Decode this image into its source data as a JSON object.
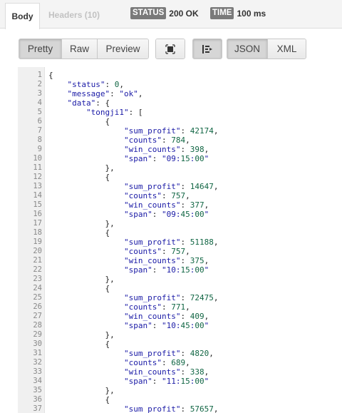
{
  "tabs": {
    "body_label": "Body",
    "headers_label": "Headers (10)"
  },
  "status": {
    "label": "STATUS",
    "value": "200 OK"
  },
  "time": {
    "label": "TIME",
    "value": "100 ms"
  },
  "toolbar": {
    "view_modes": [
      "Pretty",
      "Raw",
      "Preview"
    ],
    "formats": [
      "JSON",
      "XML"
    ],
    "icons": [
      "expand-icon",
      "wrap-icon"
    ]
  },
  "code_lines": [
    "{",
    "    \"status\": 0,",
    "    \"message\": \"ok\",",
    "    \"data\": {",
    "        \"tongji1\": [",
    "            {",
    "                \"sum_profit\": 42174,",
    "                \"counts\": 784,",
    "                \"win_counts\": 398,",
    "                \"span\": \"09:15:00\"",
    "            },",
    "            {",
    "                \"sum_profit\": 14647,",
    "                \"counts\": 757,",
    "                \"win_counts\": 377,",
    "                \"span\": \"09:45:00\"",
    "            },",
    "            {",
    "                \"sum_profit\": 51188,",
    "                \"counts\": 757,",
    "                \"win_counts\": 375,",
    "                \"span\": \"10:15:00\"",
    "            },",
    "            {",
    "                \"sum_profit\": 72475,",
    "                \"counts\": 771,",
    "                \"win_counts\": 409,",
    "                \"span\": \"10:45:00\"",
    "            },",
    "            {",
    "                \"sum_profit\": 4820,",
    "                \"counts\": 689,",
    "                \"win_counts\": 338,",
    "                \"span\": \"11:15:00\"",
    "            },",
    "            {",
    "                \"sum_profit\": 57657,"
  ]
}
